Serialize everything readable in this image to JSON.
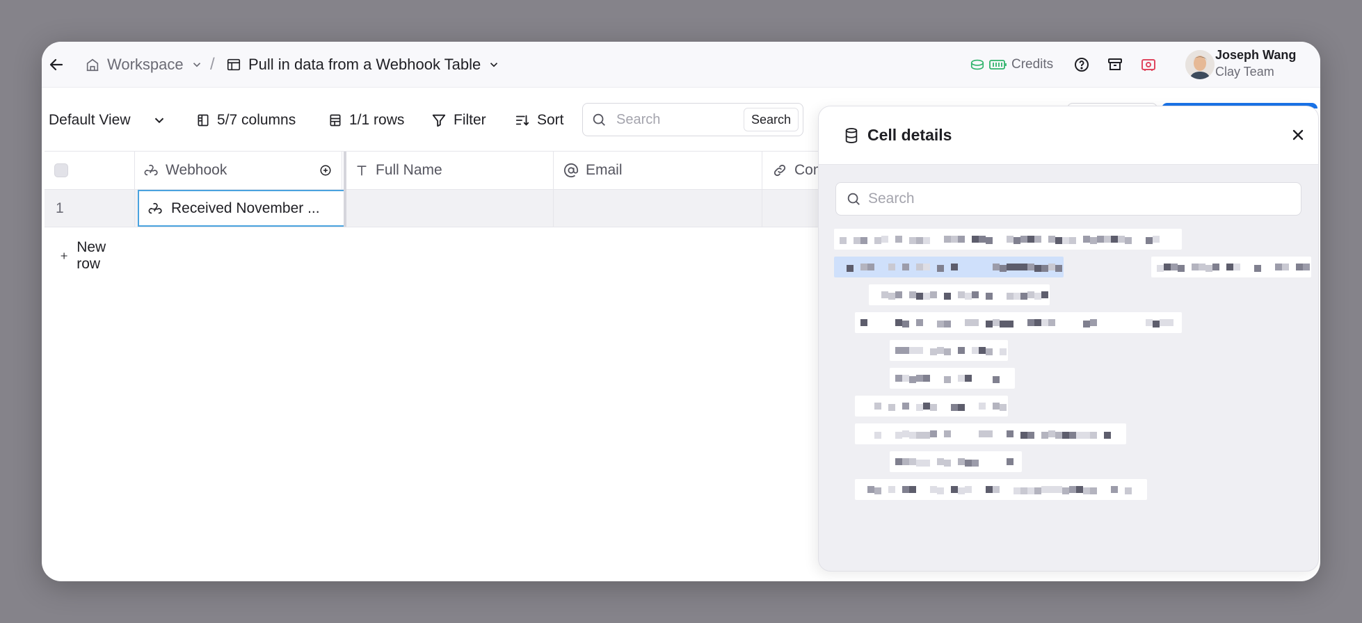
{
  "topbar": {
    "workspace_label": "Workspace",
    "separator": "/",
    "table_title": "Pull in data from a Webhook Table",
    "credits_label": "Credits",
    "user_name": "Joseph Wang",
    "user_team": "Clay Team"
  },
  "toolbar": {
    "view_label": "Default View",
    "columns_label": "5/7 columns",
    "rows_label": "1/1 rows",
    "filter_label": "Filter",
    "sort_label": "Sort",
    "search_placeholder": "Search",
    "search_button": "Search"
  },
  "grid": {
    "columns": [
      "Webhook",
      "Full Name",
      "Email",
      "Com"
    ],
    "rows": [
      {
        "index": "1",
        "webhook": "Received November ..."
      }
    ],
    "new_row_label": "New row"
  },
  "panel": {
    "title": "Cell details",
    "search_placeholder": "Search"
  },
  "colors": {
    "accent": "#1a73e8",
    "selection_border": "#4aa3df",
    "credits_icon": "#2fb36b",
    "inbox_icon": "#e0465e"
  },
  "icons": [
    "back-arrow-icon",
    "building-icon",
    "table-icon",
    "chevron-down-icon",
    "coin-icon",
    "battery-icon",
    "help-icon",
    "archive-icon",
    "gift-icon",
    "columns-icon",
    "rows-icon",
    "filter-icon",
    "sort-icon",
    "search-icon",
    "webhook-icon",
    "text-icon",
    "at-icon",
    "link-icon",
    "plus-circle-icon",
    "plus-icon",
    "database-icon",
    "close-icon"
  ]
}
